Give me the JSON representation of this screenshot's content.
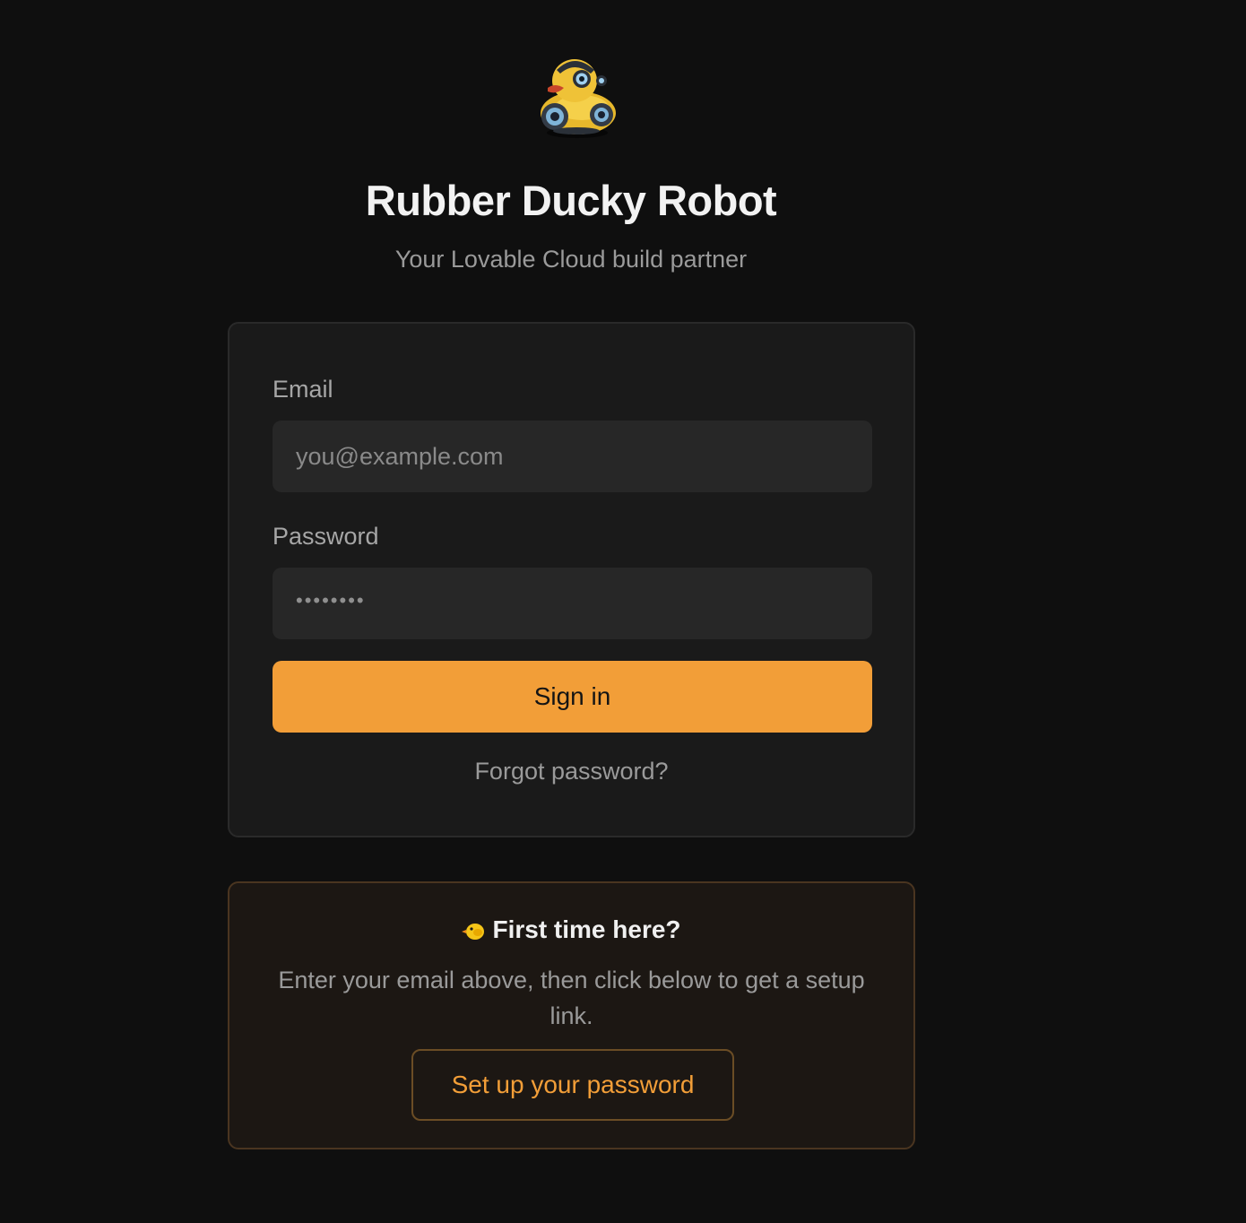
{
  "header": {
    "logo_icon": "rubber-duck-robot-icon",
    "title": "Rubber Ducky Robot",
    "subtitle": "Your Lovable Cloud build partner"
  },
  "login": {
    "email_label": "Email",
    "email_placeholder": "you@example.com",
    "password_label": "Password",
    "password_mask": "••••••••",
    "signin_label": "Sign in",
    "forgot_label": "Forgot password?"
  },
  "first_time": {
    "icon": "chick-icon",
    "title": "First time here?",
    "description": "Enter your email above, then click below to get a setup link.",
    "setup_label": "Set up your password"
  },
  "colors": {
    "background": "#0f0f0f",
    "card": "#1a1a1a",
    "accent": "#f29e38",
    "notice_bg": "#1c1713",
    "notice_border": "#4a3520"
  }
}
